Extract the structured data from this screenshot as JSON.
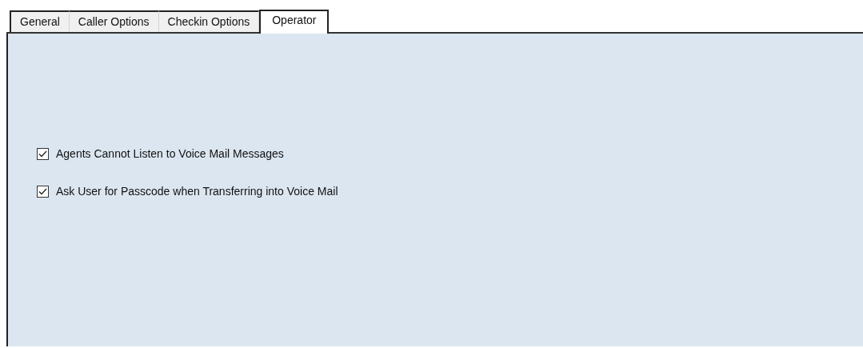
{
  "tabs": [
    {
      "label": "General",
      "selected": false
    },
    {
      "label": "Caller Options",
      "selected": false
    },
    {
      "label": "Checkin Options",
      "selected": false
    },
    {
      "label": "Operator",
      "selected": true
    }
  ],
  "options": [
    {
      "label": "Agents Cannot Listen to Voice Mail Messages",
      "checked": true
    },
    {
      "label": "Ask User for Passcode when Transferring into Voice Mail",
      "checked": true
    }
  ]
}
